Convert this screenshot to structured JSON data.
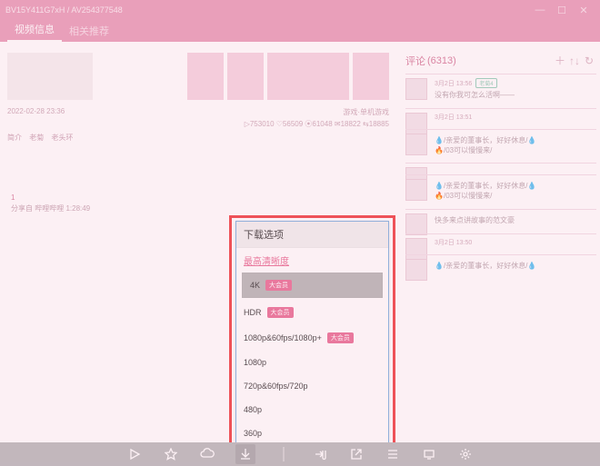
{
  "titlebar": {
    "title": "BV15Y411G7xH / AV254377548"
  },
  "tabs": {
    "a": "视频信息",
    "b": "相关推荐"
  },
  "meta": {
    "date": "2022-02-28 23:36",
    "category": "游戏·单机游戏",
    "stats": "▷753010  ♡56509  ⦿61048  ✉18822  ⇆18885",
    "tags": {
      "a": "简介",
      "b": "老菊",
      "c": "老头环"
    }
  },
  "share": {
    "one": "1",
    "line": "分享自 哔哩哔哩 1:28:49"
  },
  "comments": {
    "title": "评论",
    "count": "(6313)",
    "items": [
      {
        "ts": "3月2日 13:56",
        "badge": "老菊4",
        "txt": "没有你我可怎么活啊——"
      },
      {
        "ts": "3月2日 13:51",
        "txt": ""
      },
      {
        "ts": "",
        "txt": "♦/亲爱的董事长，好好休息/♦\n♡/03可以慢慢来/"
      },
      {
        "ts": "",
        "txt": ""
      },
      {
        "ts": "",
        "txt": "♦/亲爱的董事长，好好休息/♦\n♡/03可以慢慢来/"
      },
      {
        "ts": "",
        "txt": "快多来点讲故事的范文豪"
      },
      {
        "ts": "3月2日 13:50",
        "txt": ""
      },
      {
        "ts": "",
        "txt": "♦/亲爱的董事长，好好休息/♦"
      }
    ]
  },
  "popup": {
    "title": "下载选项",
    "section": "最高清晰度",
    "vip": "大会员",
    "opts": {
      "q4k": "4K",
      "hdr": "HDR",
      "q1080p60": "1080p&60fps/1080p+",
      "q1080p": "1080p",
      "q720p60": "720p&60fps/720p",
      "q480p": "480p",
      "q360p": "360p"
    }
  }
}
